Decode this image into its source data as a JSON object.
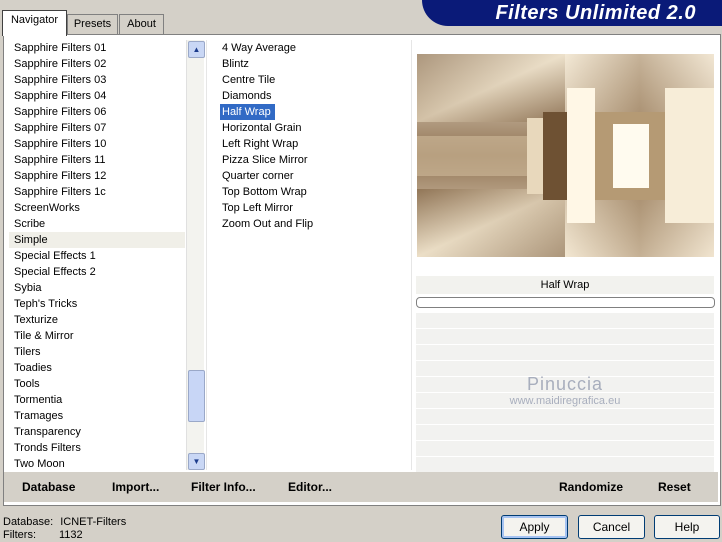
{
  "tabs": [
    {
      "label": "Navigator"
    },
    {
      "label": "Presets"
    },
    {
      "label": "About"
    }
  ],
  "app_title": "Filters Unlimited 2.0",
  "categories": [
    "Sapphire Filters 01",
    "Sapphire Filters 02",
    "Sapphire Filters 03",
    "Sapphire Filters 04",
    "Sapphire Filters 06",
    "Sapphire Filters 07",
    "Sapphire Filters 10",
    "Sapphire Filters 11",
    "Sapphire Filters 12",
    "Sapphire Filters 1c",
    "ScreenWorks",
    "Scribe",
    "Simple",
    "Special Effects 1",
    "Special Effects 2",
    "Sybia",
    "Teph's Tricks",
    "Texturize",
    "Tile & Mirror",
    "Tilers",
    "Toadies",
    "Tools",
    "Tormentia",
    "Tramages",
    "Transparency",
    "Tronds Filters",
    "Two Moon"
  ],
  "selected_category": "Simple",
  "filters": [
    "4 Way Average",
    "Blintz",
    "Centre Tile",
    "Diamonds",
    "Half Wrap",
    "Horizontal Grain",
    "Left Right Wrap",
    "Pizza Slice Mirror",
    "Quarter corner",
    "Top Bottom Wrap",
    "Top Left Mirror",
    "Zoom Out and Flip"
  ],
  "selected_filter": "Half Wrap",
  "preview": {
    "filter_name": "Half Wrap"
  },
  "watermark": {
    "line1": "Pinuccia",
    "line2": "www.maidiregrafica.eu"
  },
  "bottom_links": {
    "database": "Database",
    "import": "Import...",
    "filter_info": "Filter Info...",
    "editor": "Editor...",
    "randomize": "Randomize",
    "reset": "Reset"
  },
  "status": {
    "database_label": "Database:",
    "database_value": "ICNET-Filters",
    "filters_label": "Filters:",
    "filters_value": "1132"
  },
  "buttons": {
    "apply": "Apply",
    "cancel": "Cancel",
    "help": "Help"
  },
  "colors": {
    "banner": "#0a1a78",
    "selection": "#316ac5"
  }
}
